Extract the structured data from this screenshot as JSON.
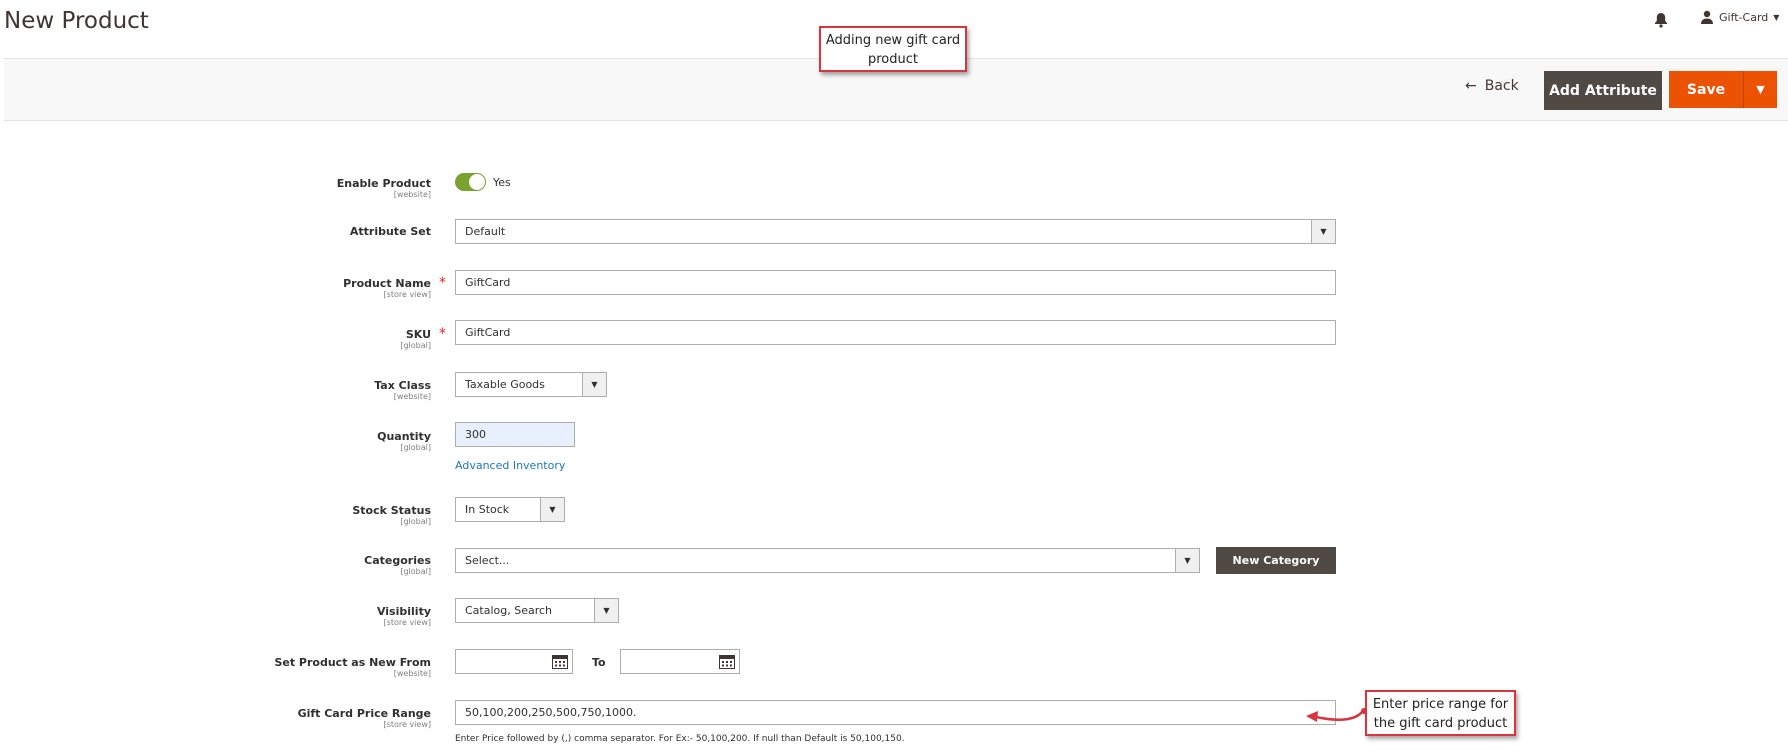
{
  "page": {
    "title": "New Product",
    "user_name": "Gift-Card"
  },
  "toolbar": {
    "back_label": "Back",
    "add_attribute_label": "Add Attribute",
    "save_label": "Save"
  },
  "callouts": {
    "top": "Adding new gift card product",
    "bottom": "Enter price range for the gift card product"
  },
  "form": {
    "enable_product": {
      "label": "Enable Product",
      "scope": "[website]",
      "value": "Yes"
    },
    "attribute_set": {
      "label": "Attribute Set",
      "value": "Default"
    },
    "product_name": {
      "label": "Product Name",
      "scope": "[store view]",
      "value": "GiftCard",
      "required_mark": "*"
    },
    "sku": {
      "label": "SKU",
      "scope": "[global]",
      "value": "GiftCard",
      "required_mark": "*"
    },
    "tax_class": {
      "label": "Tax Class",
      "scope": "[website]",
      "value": "Taxable Goods"
    },
    "quantity": {
      "label": "Quantity",
      "scope": "[global]",
      "value": "300",
      "link": "Advanced Inventory"
    },
    "stock_status": {
      "label": "Stock Status",
      "scope": "[global]",
      "value": "In Stock"
    },
    "categories": {
      "label": "Categories",
      "scope": "[global]",
      "placeholder": "Select...",
      "button": "New Category"
    },
    "visibility": {
      "label": "Visibility",
      "scope": "[store view]",
      "value": "Catalog, Search"
    },
    "new_from": {
      "label": "Set Product as New From",
      "scope": "[website]",
      "to_label": "To"
    },
    "price_range": {
      "label": "Gift Card Price Range",
      "scope": "[store view]",
      "value": "50,100,200,250,500,750,1000.",
      "note": "Enter Price followed by (,) comma separator. For Ex:- 50,100,200. If null than Default is 50,100,150."
    }
  },
  "icons": [
    "bell-icon",
    "user-icon",
    "caret-down-icon",
    "arrow-left-icon",
    "calendar-icon",
    "select-arrow-icon"
  ],
  "colors": {
    "accent": "#eb5202",
    "dark_button": "#514943",
    "toggle_on": "#79a22e",
    "link": "#1979c3",
    "callout_border": "#d9353f"
  }
}
